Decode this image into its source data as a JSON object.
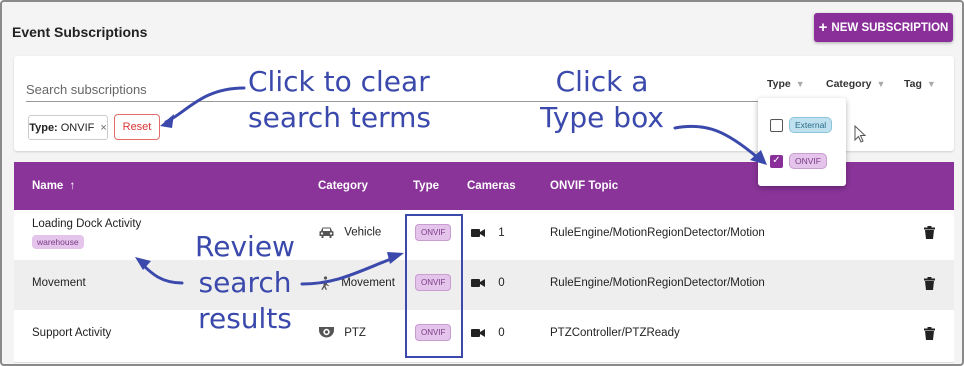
{
  "header": {
    "title": "Event Subscriptions",
    "new_button_label": "NEW SUBSCRIPTION",
    "new_button_icon": "plus-icon"
  },
  "search": {
    "placeholder": "Search subscriptions",
    "chip_key": "Type:",
    "chip_value": "ONVIF",
    "chip_remove": "×",
    "reset_label": "Reset"
  },
  "filters": {
    "type": "Type",
    "category": "Category",
    "tag": "Tag"
  },
  "type_dropdown": {
    "options": [
      {
        "label": "External",
        "checked": false
      },
      {
        "label": "ONVIF",
        "checked": true
      }
    ]
  },
  "table": {
    "headers": {
      "name": "Name",
      "sort_arrow": "↑",
      "category": "Category",
      "type": "Type",
      "cameras": "Cameras",
      "topic": "ONVIF Topic"
    },
    "rows": [
      {
        "name": "Loading Dock Activity",
        "tag": "warehouse",
        "category": "Vehicle",
        "category_icon": "car-icon",
        "type": "ONVIF",
        "cameras": "1",
        "topic": "RuleEngine/MotionRegionDetector/Motion"
      },
      {
        "name": "Movement",
        "tag": "",
        "category": "Movement",
        "category_icon": "walking-person-icon",
        "type": "ONVIF",
        "cameras": "0",
        "topic": "RuleEngine/MotionRegionDetector/Motion"
      },
      {
        "name": "Support Activity",
        "tag": "",
        "category": "PTZ",
        "category_icon": "ptz-camera-icon",
        "type": "ONVIF",
        "cameras": "0",
        "topic": "PTZController/PTZReady"
      }
    ]
  },
  "annotations": {
    "clear": [
      "Click to clear",
      "search terms"
    ],
    "type_box": [
      "Click a",
      "Type box"
    ],
    "review": [
      "Review",
      "search",
      "results"
    ]
  },
  "colors": {
    "accent": "#8a2f9a",
    "annotation": "#3a49ab",
    "reset": "#d93535"
  }
}
